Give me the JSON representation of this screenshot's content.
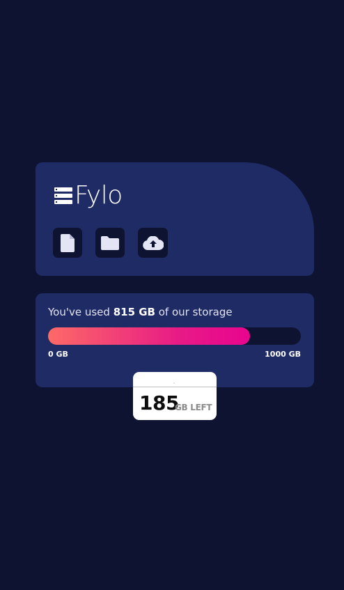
{
  "brand": {
    "name": "Fylo",
    "logo_icon": "server-stack-icon"
  },
  "actions": [
    {
      "name": "document-icon"
    },
    {
      "name": "folder-icon"
    },
    {
      "name": "upload-icon"
    }
  ],
  "storage": {
    "text_prefix": "You've used ",
    "used": "815 GB",
    "text_suffix": " of our storage",
    "used_fraction": 0.815,
    "min_label": "0 GB",
    "max_label": "1000 GB",
    "remaining_value": "185",
    "remaining_unit": "GB LEFT"
  },
  "colors": {
    "background": "#0d1330",
    "card": "#1f2b64",
    "bar_start": "#fd6a67",
    "bar_end": "#e8058f",
    "icon_fill": "#e3e4f4"
  }
}
